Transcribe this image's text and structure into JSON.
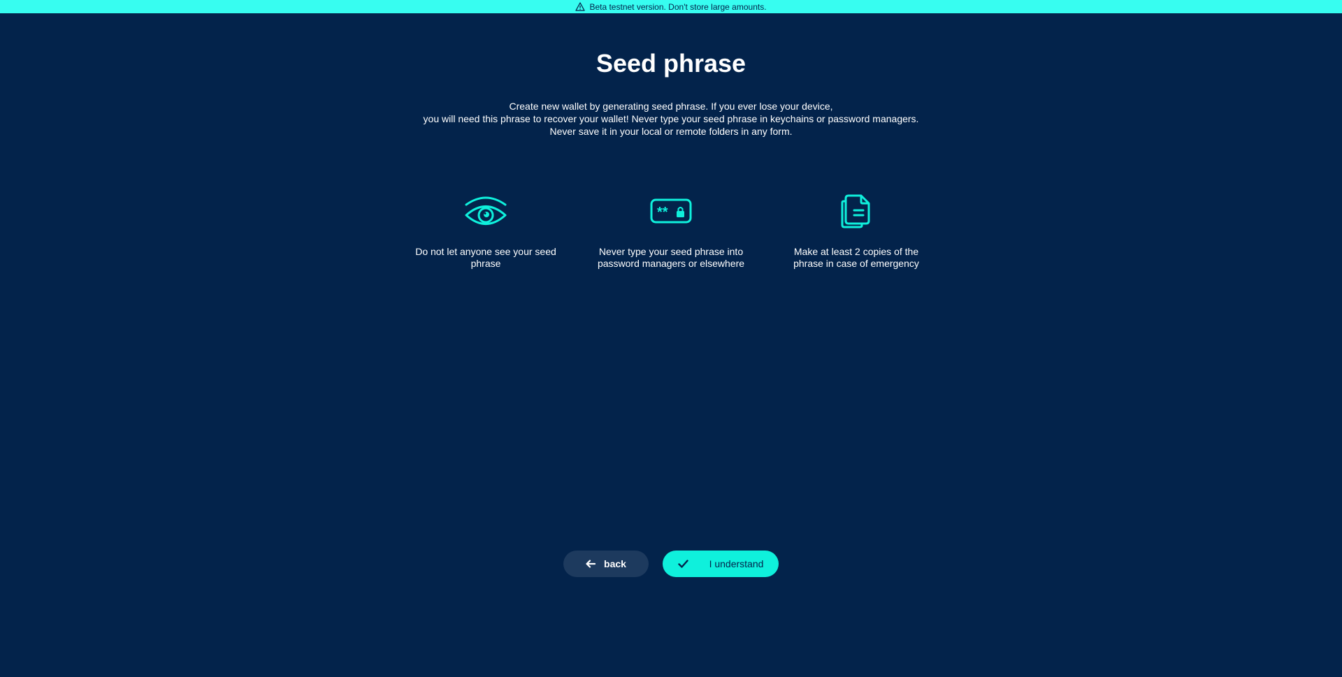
{
  "banner": {
    "icon": "warning-triangle-icon",
    "text": "Beta testnet version. Don't store large amounts."
  },
  "page": {
    "title": "Seed phrase",
    "description_lines": [
      "Create new wallet by generating seed phrase. If you ever lose your device,",
      "you will need this phrase to recover your wallet! Never type your seed phrase in keychains or password managers.",
      "Never save it in your local or remote folders in any form."
    ]
  },
  "tips": [
    {
      "icon": "eye-icon",
      "text": "Do not let anyone see your seed phrase"
    },
    {
      "icon": "password-field-icon",
      "text": "Never type your seed phrase into password managers or elsewhere"
    },
    {
      "icon": "copy-documents-icon",
      "text": "Make at least 2 copies of the phrase in case of emergency"
    }
  ],
  "buttons": {
    "back_label": "back",
    "understand_label": "I understand"
  },
  "colors": {
    "background": "#03234b",
    "banner": "#37fdf0",
    "accent": "#0ff0dc",
    "back_button": "#1d3a5e"
  }
}
